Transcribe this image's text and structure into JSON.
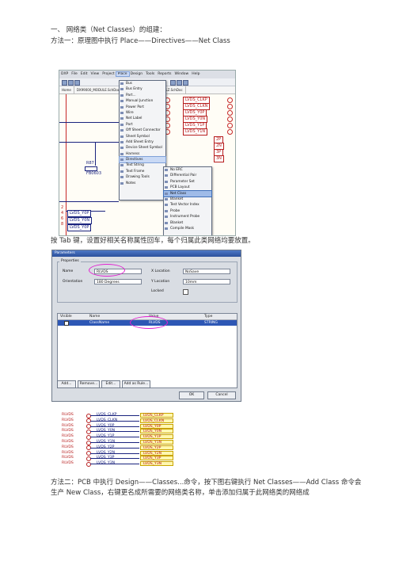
{
  "doc": {
    "heading": "一、 网络类（Net Classes）的组建：",
    "method1": "方法一：原理图中执行 Place——Directives——Net Class",
    "tab_note": "按 Tab 键，设置好相关名称属性回车，每个归属此类网络均要放置。",
    "method2": "方法二：PCB 中执行 Design——Classes...命令，按下图右键执行 Net Classes——Add Class 命令会生产 New Class，右键更名成所需要的网络类名称，单击添加归属于此网络类的网络成"
  },
  "screenshot1": {
    "menubar": [
      "DXP",
      "File",
      "Edit",
      "View",
      "Project",
      "Place",
      "Design",
      "Tools",
      "Reports",
      "Window",
      "Help"
    ],
    "tabs": [
      "Home",
      "DX99000_MODULE.SchDoc",
      "SK_17005.SchDoc",
      "DK1LZ.SchDoc"
    ],
    "place_menu": [
      "Bus",
      "Bus Entry",
      "Part...",
      "Manual Junction",
      "Power Port",
      "Wire",
      "Net Label",
      "Port",
      "Off Sheet Connector",
      "Sheet Symbol",
      "Add Sheet Entry",
      "Device Sheet Symbol",
      "Harness",
      "Directives",
      "Text String",
      "Text Frame",
      "Drawing Tools",
      "Notes"
    ],
    "directives_menu": [
      "No ERC",
      "Differential Pair",
      "Parameter Set",
      "PCB Layout",
      "Net Class",
      "Blanket",
      "Test Vector Index",
      "Probe",
      "Instrument Probe",
      "Blanket",
      "Compile Mask"
    ],
    "netlabels": [
      "LVDS_CLKP",
      "LVDS_CLKN",
      "LVDS_Y0P",
      "LVDS_Y0N",
      "LVDS_Y1P",
      "LVDS_Y1N"
    ],
    "netlabels_partial": [
      "2P",
      "2N",
      "3P",
      "3N"
    ],
    "resistor": "R87",
    "resistor_value": "FB0603",
    "pin_numbers": [
      "2",
      "4",
      "6",
      "8"
    ],
    "bottom_labels": [
      "LVDS_Y0P",
      "LVDS_Y0N",
      "LVDS_Y0P"
    ]
  },
  "screenshot2": {
    "title": "Parameters",
    "group": "Properties",
    "name_label": "Name",
    "name_value": "RLVDS",
    "orientation_label": "Orientation",
    "orientation_value": "180 Degrees",
    "xloc_label": "X Location",
    "xloc_value": "NoSave",
    "yloc_label": "Y Location",
    "yloc_value": "10mm",
    "locked_label": "Locked",
    "grid_headers": [
      "Visible",
      "Name",
      "Value",
      "Type"
    ],
    "grid_row": {
      "name": "ClassName",
      "value": "RLVDS",
      "type": "STRING"
    },
    "buttons": [
      "Add...",
      "Remove...",
      "Edit...",
      "Add as Rule..."
    ],
    "ok": "OK",
    "cancel": "Cancel"
  },
  "screenshot3": {
    "left_label": "RLVDS",
    "rows": [
      {
        "mid": "LVDS_CLKP",
        "right": "LVDS_CLKP"
      },
      {
        "mid": "LVDS_CLKN",
        "right": "LVDS_CLKN"
      },
      {
        "mid": "LVDS_Y0P",
        "right": "LVDS_Y0P"
      },
      {
        "mid": "LVDS_Y0N",
        "right": "LVDS_Y0N"
      },
      {
        "mid": "LVDS_Y1P",
        "right": "LVDS_Y1P"
      },
      {
        "mid": "LVDS_Y1N",
        "right": "LVDS_Y1N"
      },
      {
        "mid": "LVDS_Y2P",
        "right": "LVDS_Y2P"
      },
      {
        "mid": "LVDS_Y2N",
        "right": "LVDS_Y2N"
      },
      {
        "mid": "LVDS_Y3P",
        "right": "LVDS_Y3P"
      },
      {
        "mid": "LVDS_Y3N",
        "right": "LVDS_Y3N"
      }
    ]
  }
}
